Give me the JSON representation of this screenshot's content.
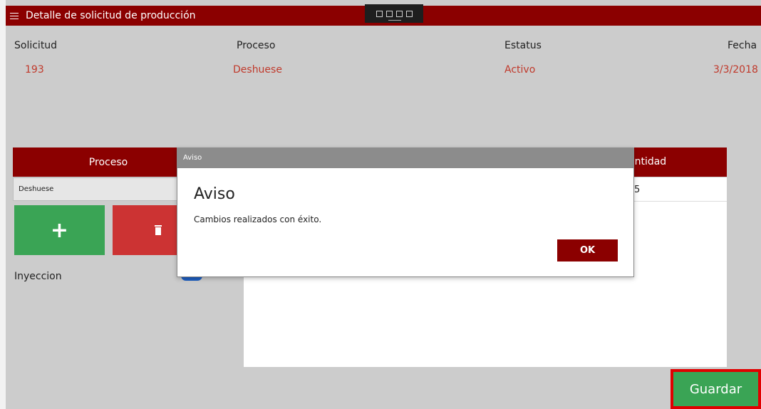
{
  "app": {
    "title": "Detalle de solicitud de producción"
  },
  "colors": {
    "brand": "#8b0000",
    "add": "#3aa455",
    "delete": "#cc3333",
    "value_text": "#c0392b",
    "highlight": "#e00000"
  },
  "header": {
    "labels": {
      "solicitud": "Solicitud",
      "proceso": "Proceso",
      "estatus": "Estatus",
      "fecha": "Fecha"
    },
    "values": {
      "solicitud": "193",
      "proceso": "Deshuese",
      "estatus": "Activo",
      "fecha": "3/3/2018"
    }
  },
  "left_panel": {
    "column_header": "Proceso",
    "rows": [
      "Deshuese"
    ],
    "add_icon": "plus-icon",
    "delete_icon": "trash-icon",
    "inyeccion_label": "Inyeccion"
  },
  "detail_table": {
    "column_header": "antidad",
    "rows": [
      {
        "cantidad": "5"
      }
    ]
  },
  "actions": {
    "guardar_label": "Guardar"
  },
  "dialog": {
    "titlebar": "Aviso",
    "heading": "Aviso",
    "message": "Cambios realizados con éxito.",
    "ok_label": "OK"
  }
}
